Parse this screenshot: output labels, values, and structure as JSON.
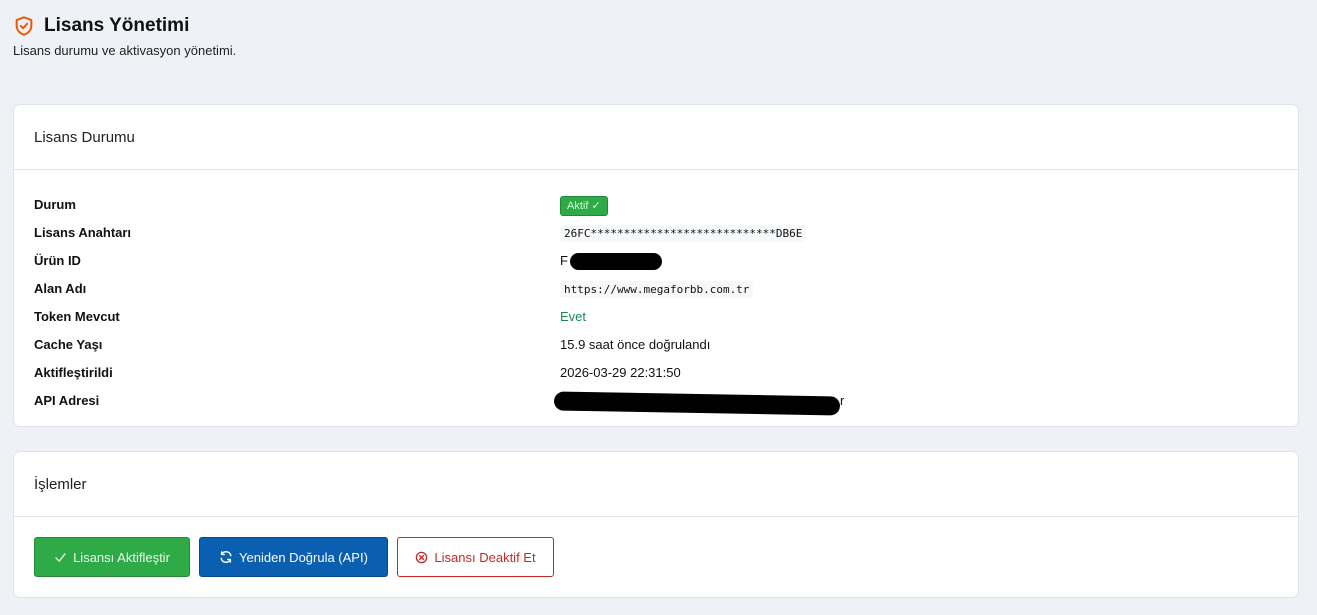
{
  "header": {
    "title": "Lisans Yönetimi",
    "subtitle": "Lisans durumu ve aktivasyon yönetimi."
  },
  "status_card": {
    "title": "Lisans Durumu",
    "rows": [
      {
        "label": "Durum",
        "value": "Aktif ✓"
      },
      {
        "label": "Lisans Anahtarı",
        "value": "26FC****************************DB6E"
      },
      {
        "label": "Ürün ID",
        "value": "F"
      },
      {
        "label": "Alan Adı",
        "value": "https://www.megaforbb.com.tr"
      },
      {
        "label": "Token Mevcut",
        "value": "Evet"
      },
      {
        "label": "Cache Yaşı",
        "value": "15.9 saat önce doğrulandı"
      },
      {
        "label": "Aktifleştirildi",
        "value": "2026-03-29 22:31:50"
      },
      {
        "label": "API Adresi",
        "value": "r"
      }
    ]
  },
  "actions_card": {
    "title": "İşlemler",
    "buttons": {
      "activate": "Lisansı Aktifleştir",
      "revalidate": "Yeniden Doğrula (API)",
      "deactivate": "Lisansı Deaktif Et"
    }
  },
  "colors": {
    "accent_orange": "#e8590c",
    "success_green": "#2eaa46",
    "primary_blue": "#0b5fb0",
    "danger_red": "#c62828"
  },
  "icons": {
    "title": "shield-check-icon",
    "activate": "check-icon",
    "revalidate": "refresh-icon",
    "deactivate": "circle-x-icon"
  }
}
